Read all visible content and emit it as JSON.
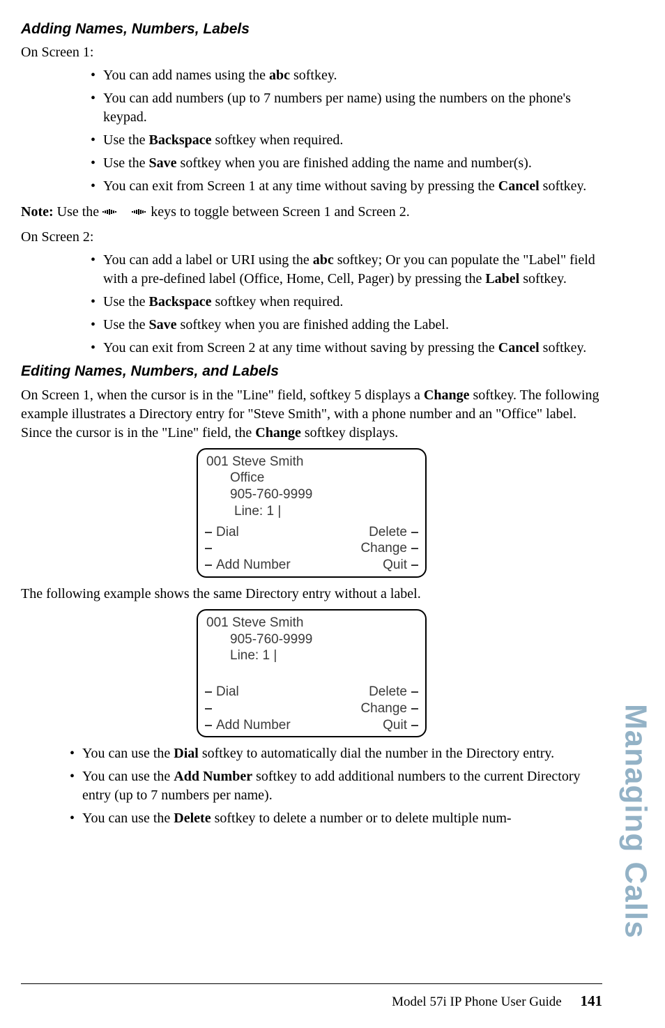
{
  "h1": "Adding Names, Numbers, Labels",
  "p_onscreen1": "On Screen 1:",
  "screen1_list": {
    "i1_a": "You can add names using the ",
    "i1_b": "abc",
    "i1_c": " softkey.",
    "i2": "You can add numbers (up to 7 numbers per name) using the numbers on the phone's keypad.",
    "i3_a": "Use the ",
    "i3_b": "Backspace",
    "i3_c": " softkey when required.",
    "i4_a": "Use the ",
    "i4_b": "Save",
    "i4_c": " softkey when you are finished adding the name and number(s).",
    "i5_a": "You can exit from Screen 1 at any time without saving by pressing the ",
    "i5_b": "Cancel",
    "i5_c": " softkey."
  },
  "note": {
    "prefix": "Note:",
    "a": " Use the ",
    "b": " keys to toggle between Screen 1 and Screen 2."
  },
  "p_onscreen2": "On Screen 2:",
  "screen2_list": {
    "i1_a": "You can add a label or URI using the ",
    "i1_b": "abc",
    "i1_c": " softkey; Or you can populate the \"Label\" field with a pre-defined label (Office, Home, Cell, Pager) by pressing the ",
    "i1_d": "Label",
    "i1_e": " softkey.",
    "i2_a": "Use the ",
    "i2_b": "Backspace",
    "i2_c": " softkey when required.",
    "i3_a": "Use the ",
    "i3_b": "Save",
    "i3_c": " softkey when you are finished adding the Label.",
    "i4_a": "You can exit from Screen 2 at any time without saving by pressing the ",
    "i4_b": "Cancel",
    "i4_c": " softkey."
  },
  "h2": "Editing Names, Numbers, and Labels",
  "edit_para_a": "On Screen 1, when the cursor is in the \"Line\" field, softkey 5 displays a ",
  "edit_para_b": "Change",
  "edit_para_c": " softkey. The following example illustrates a Directory entry for \"Steve Smith\", with a phone number and an \"Office\" label. Since the cursor is in the \"Line\" field, the ",
  "edit_para_d": "Change",
  "edit_para_e": " softkey displays.",
  "screenA": {
    "l1": "001  Steve Smith",
    "l2": "Office",
    "l3": "905-760-9999",
    "l4": "Line: 1 |",
    "sk_dial": "Dial",
    "sk_addnum": "Add Number",
    "sk_delete": "Delete",
    "sk_change": "Change",
    "sk_quit": "Quit"
  },
  "between": "The following example shows the same Directory entry without a label.",
  "screenB": {
    "l1": "001  Steve Smith",
    "l2": "905-760-9999",
    "l3": "Line: 1 |",
    "sk_dial": "Dial",
    "sk_addnum": "Add Number",
    "sk_delete": "Delete",
    "sk_change": "Change",
    "sk_quit": "Quit"
  },
  "below_list": {
    "i1_a": "You can use the ",
    "i1_b": "Dial",
    "i1_c": " softkey to automatically dial the number in the Directory entry.",
    "i2_a": "You can use the ",
    "i2_b": "Add Number",
    "i2_c": " softkey to add additional numbers to the current Directory entry (up to 7 numbers per name).",
    "i3_a": "You can use the ",
    "i3_b": "Delete",
    "i3_c": " softkey to delete a number or to delete multiple num-"
  },
  "sidetab": "Managing Calls",
  "footer_text": "Model 57i IP Phone User Guide",
  "footer_page": "141"
}
